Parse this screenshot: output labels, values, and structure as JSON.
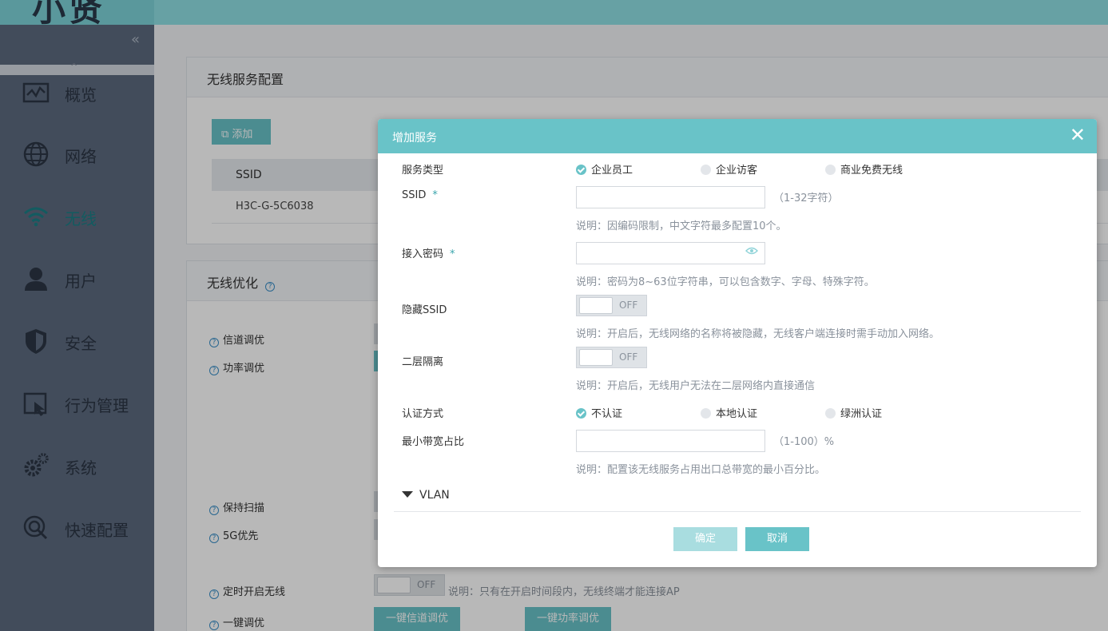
{
  "header": {
    "logo_text": "小贤"
  },
  "sidebar": {
    "collapse": "«",
    "scroll_arrow": "^",
    "items": [
      {
        "label": "概览",
        "icon": "overview-chart-icon"
      },
      {
        "label": "网络",
        "icon": "globe-icon"
      },
      {
        "label": "无线",
        "icon": "wifi-icon",
        "active": true
      },
      {
        "label": "用户",
        "icon": "user-icon"
      },
      {
        "label": "安全",
        "icon": "shield-icon"
      },
      {
        "label": "行为管理",
        "icon": "behavior-management-icon"
      },
      {
        "label": "系统",
        "icon": "gear-icon"
      },
      {
        "label": "快速配置",
        "icon": "quick-config-icon"
      }
    ]
  },
  "main": {
    "service_panel": {
      "title": "无线服务配置",
      "add_button": "添加",
      "table_header": "SSID",
      "rows": [
        "H3C-G-5C6038"
      ]
    },
    "optimize_panel": {
      "title": "无线优化",
      "options": [
        "信道调优",
        "功率调优",
        "保持扫描",
        "5G优先",
        "定时开启无线",
        "一键调优"
      ],
      "schedule_toggle": "OFF",
      "schedule_desc": "说明：只有在开启时间段内，无线终端才能连接AP",
      "channel_button": "一键信道调优",
      "power_button": "一键功率调优"
    }
  },
  "dialog": {
    "title": "增加服务",
    "close": "✕",
    "service_type": {
      "label": "服务类型",
      "options": [
        "企业员工",
        "企业访客",
        "商业免费无线"
      ],
      "selected": "企业员工"
    },
    "ssid": {
      "label": "SSID",
      "required": "*",
      "value": "",
      "hint": "（1-32字符）",
      "desc": "说明：因编码限制，中文字符最多配置10个。"
    },
    "password": {
      "label": "接入密码",
      "required": "*",
      "value": "",
      "desc": "说明：密码为8~63位字符串，可以包含数字、字母、特殊字符。"
    },
    "hide_ssid": {
      "label": "隐藏SSID",
      "state": "OFF",
      "desc": "说明：开启后，无线网络的名称将被隐藏，无线客户端连接时需手动加入网络。"
    },
    "l2_isolation": {
      "label": "二层隔离",
      "state": "OFF",
      "desc": "说明：开启后，无线用户无法在二层网络内直接通信"
    },
    "auth": {
      "label": "认证方式",
      "options": [
        "不认证",
        "本地认证",
        "绿洲认证"
      ],
      "selected": "不认证"
    },
    "bandwidth": {
      "label": "最小带宽占比",
      "value": "",
      "hint": "（1-100）%",
      "desc": "说明：配置该无线服务占用出口总带宽的最小百分比。"
    },
    "vlan": {
      "label": "VLAN"
    },
    "confirm": "确定",
    "cancel": "取消"
  }
}
